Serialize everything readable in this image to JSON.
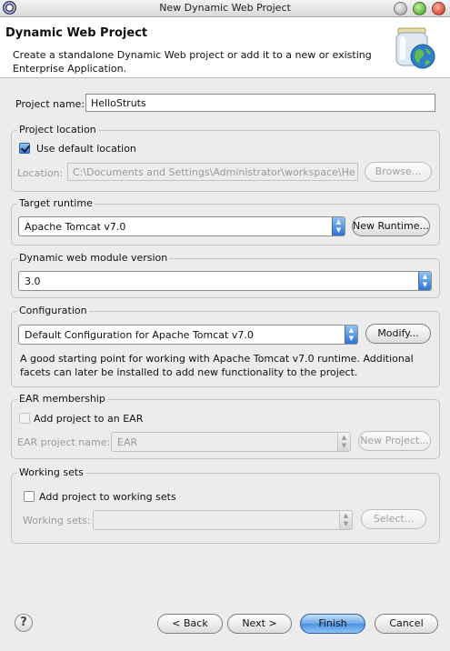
{
  "window": {
    "title": "New Dynamic Web Project"
  },
  "header": {
    "title": "Dynamic Web Project",
    "description": "Create a standalone Dynamic Web project or add it to a new or existing Enterprise Application."
  },
  "project_name": {
    "label": "Project name:",
    "value": "HelloStruts"
  },
  "project_location": {
    "group_label": "Project location",
    "use_default_label": "Use default location",
    "use_default_checked": true,
    "location_label": "Location:",
    "location_value": "C:\\Documents and Settings\\Administrator\\workspace\\He",
    "browse_label": "Browse..."
  },
  "target_runtime": {
    "group_label": "Target runtime",
    "selected": "Apache Tomcat v7.0",
    "new_runtime_label": "New Runtime..."
  },
  "web_module": {
    "group_label": "Dynamic web module version",
    "selected": "3.0"
  },
  "configuration": {
    "group_label": "Configuration",
    "selected": "Default Configuration for Apache Tomcat v7.0",
    "modify_label": "Modify...",
    "description": "A good starting point for working with Apache Tomcat v7.0 runtime. Additional facets can later be installed to add new functionality to the project."
  },
  "ear_membership": {
    "group_label": "EAR membership",
    "add_label": "Add project to an EAR",
    "add_checked": false,
    "ear_name_label": "EAR project name:",
    "ear_name_value": "EAR",
    "new_project_label": "New Project..."
  },
  "working_sets": {
    "group_label": "Working sets",
    "add_label": "Add project to working sets",
    "add_checked": false,
    "sets_label": "Working sets:",
    "select_label": "Select..."
  },
  "footer": {
    "back_label": "< Back",
    "next_label": "Next >",
    "finish_label": "Finish",
    "cancel_label": "Cancel",
    "help_glyph": "?"
  },
  "colors": {
    "accent": "#4a90e0",
    "banner_bg": "#ffffff",
    "dialog_bg": "#ececec"
  }
}
